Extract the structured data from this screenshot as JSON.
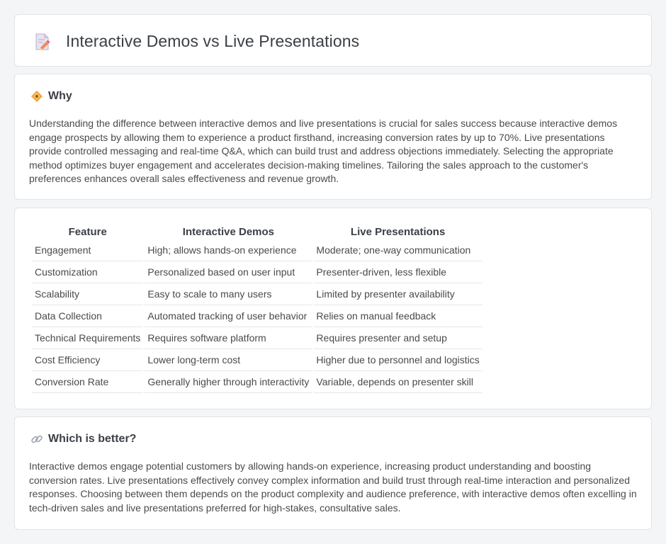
{
  "header": {
    "title": "Interactive Demos vs Live Presentations",
    "icon": "document-pencil-icon"
  },
  "why": {
    "icon": "diamond-icon",
    "title": "Why",
    "text": "Understanding the difference between interactive demos and live presentations is crucial for sales success because interactive demos engage prospects by allowing them to experience a product firsthand, increasing conversion rates by up to 70%. Live presentations provide controlled messaging and real-time Q&A, which can build trust and address objections immediately. Selecting the appropriate method optimizes buyer engagement and accelerates decision-making timelines. Tailoring the sales approach to the customer's preferences enhances overall sales effectiveness and revenue growth."
  },
  "comparison": {
    "columns": [
      "Feature",
      "Interactive Demos",
      "Live Presentations"
    ],
    "rows": [
      [
        "Engagement",
        "High; allows hands-on experience",
        "Moderate; one-way communication"
      ],
      [
        "Customization",
        "Personalized based on user input",
        "Presenter-driven, less flexible"
      ],
      [
        "Scalability",
        "Easy to scale to many users",
        "Limited by presenter availability"
      ],
      [
        "Data Collection",
        "Automated tracking of user behavior",
        "Relies on manual feedback"
      ],
      [
        "Technical Requirements",
        "Requires software platform",
        "Requires presenter and setup"
      ],
      [
        "Cost Efficiency",
        "Lower long-term cost",
        "Higher due to personnel and logistics"
      ],
      [
        "Conversion Rate",
        "Generally higher through interactivity",
        "Variable, depends on presenter skill"
      ]
    ]
  },
  "better": {
    "icon": "link-icon",
    "title": "Which is better?",
    "text": "Interactive demos engage potential customers by allowing hands-on experience, increasing product understanding and boosting conversion rates. Live presentations effectively convey complex information and build trust through real-time interaction and personalized responses. Choosing between them depends on the product complexity and audience preference, with interactive demos often excelling in tech-driven sales and live presentations preferred for high-stakes, consultative sales."
  },
  "colors": {
    "background": "#f4f5f7",
    "card": "#ffffff",
    "heading": "#3b3f45",
    "text": "#4a4a4a",
    "accent_orange": "#f2a43a"
  }
}
